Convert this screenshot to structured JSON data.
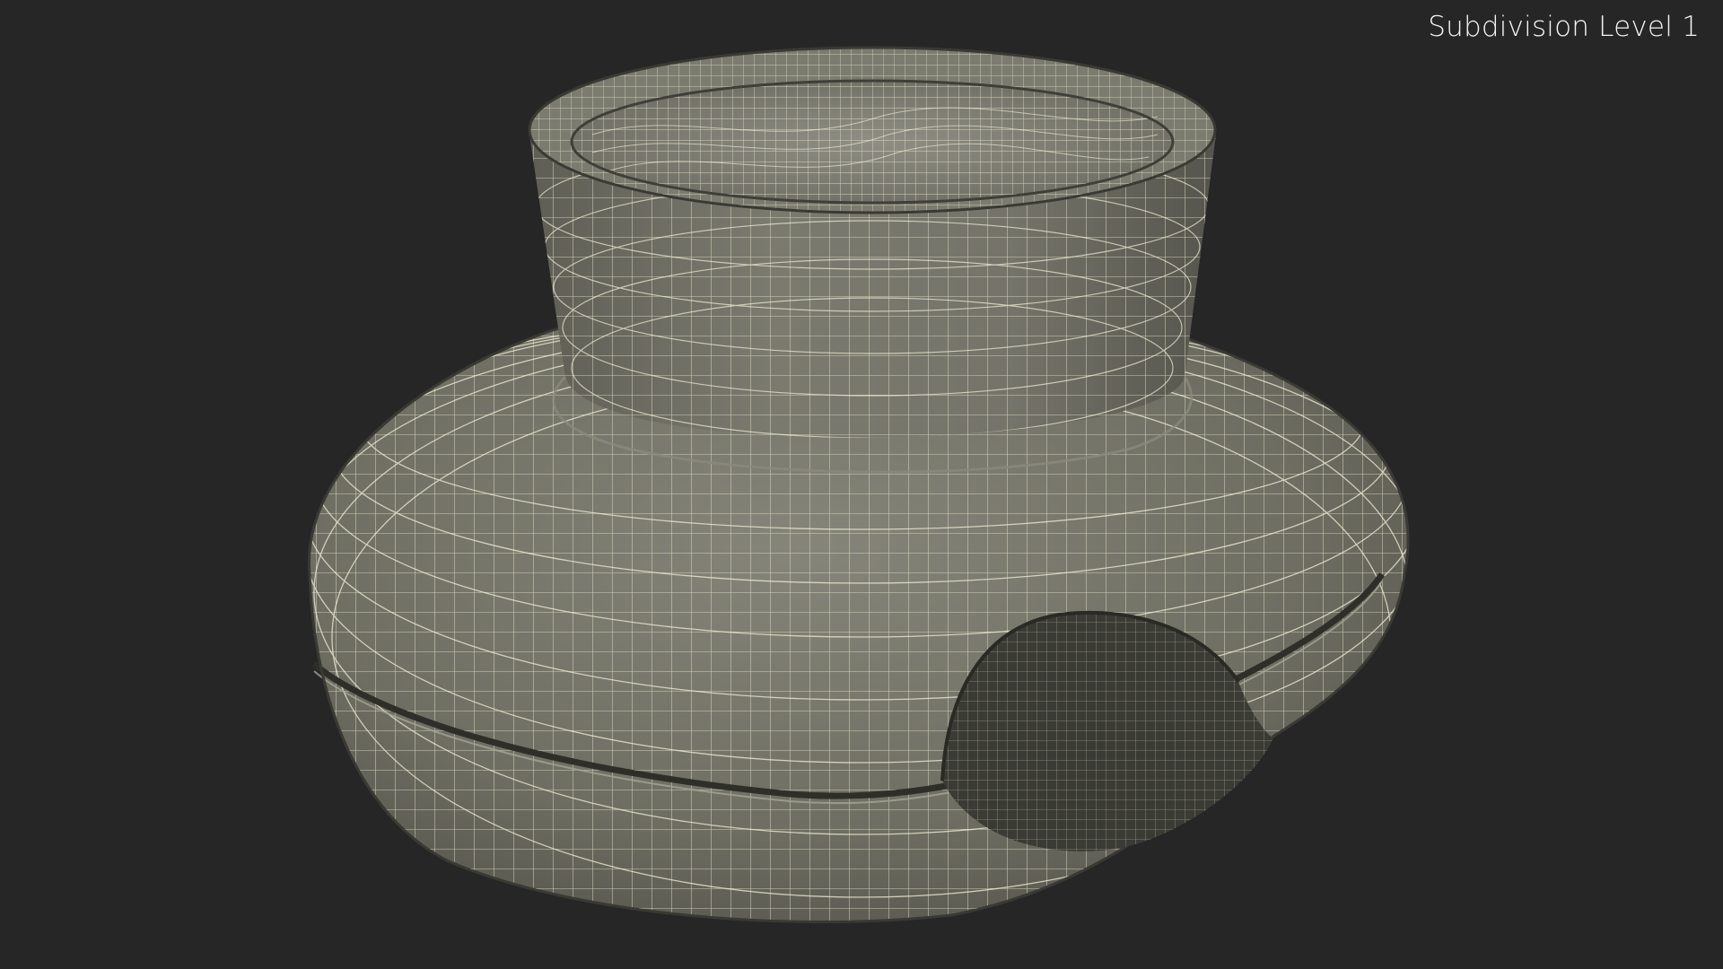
{
  "viewport": {
    "overlay_label": "Subdivision Level 1"
  },
  "colors": {
    "background": "#262626",
    "mesh_surface": "#76766a",
    "mesh_shadow": "#4e4e45",
    "wire": "#f3f0d9",
    "overlay_text": "#f2f2f2"
  },
  "model": {
    "subject": "wireframe mesh render (subdivision preview)"
  }
}
